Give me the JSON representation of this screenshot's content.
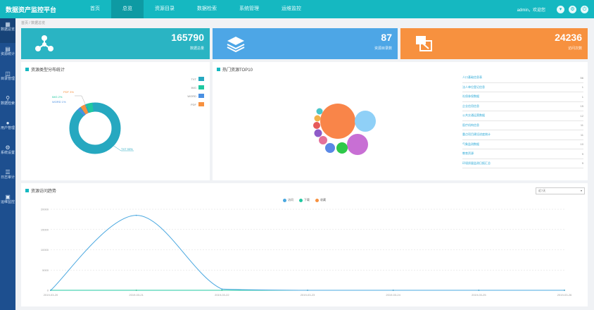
{
  "app": {
    "title": "数据资产监控平台"
  },
  "nav": [
    {
      "label": "首页",
      "active": false
    },
    {
      "label": "总览",
      "active": true
    },
    {
      "label": "资源目录",
      "active": false
    },
    {
      "label": "数据检索",
      "active": false
    },
    {
      "label": "系统管理",
      "active": false
    },
    {
      "label": "运维监控",
      "active": false
    }
  ],
  "user": {
    "name": "admin，欢迎您"
  },
  "sidebar": [
    {
      "label": "数据总览",
      "icon": "grid-icon"
    },
    {
      "label": "资源统计",
      "icon": "chart-icon"
    },
    {
      "label": "目录管理",
      "icon": "folder-icon"
    },
    {
      "label": "数据检索",
      "icon": "search-icon"
    },
    {
      "label": "用户管理",
      "icon": "user-icon"
    },
    {
      "label": "系统设置",
      "icon": "gear-icon"
    },
    {
      "label": "日志审计",
      "icon": "log-icon"
    },
    {
      "label": "运维监控",
      "icon": "monitor-icon"
    }
  ],
  "breadcrumb": "首页 / 数据总览",
  "stats": [
    {
      "value": "165790",
      "label": "数据总量",
      "icon": "share-icon",
      "color": "#2ab4c3"
    },
    {
      "value": "87",
      "label": "资源目录数",
      "icon": "layers-icon",
      "color": "#4da6e6"
    },
    {
      "value": "24236",
      "label": "访问次数",
      "icon": "share-screen-icon",
      "color": "#f7913f"
    }
  ],
  "donut_panel": {
    "title": "资源类型分布统计",
    "legend": [
      {
        "label": "TXT",
        "color": "#26a8c0"
      },
      {
        "label": "IMG",
        "color": "#1fc8a0"
      },
      {
        "label": "WORD",
        "color": "#4a90e2"
      },
      {
        "label": "PDF",
        "color": "#f7913f"
      }
    ],
    "big_label": "TXT 93%",
    "small_labels": [
      "IMG 2%",
      "WORD 1%",
      "PDF 3%"
    ]
  },
  "bubble_panel": {
    "title": "热门资源TOP10",
    "rows": [
      {
        "name": "人口基础信息表",
        "count": "56"
      },
      {
        "name": "法人单位登记信息",
        "count": "1"
      },
      {
        "name": "社保参保数据",
        "count": "1"
      },
      {
        "name": "企业信用信息",
        "count": "15"
      },
      {
        "name": "公共交通运营数据",
        "count": "12"
      },
      {
        "name": "医疗机构信息",
        "count": "11"
      },
      {
        "name": "重点项目建设进度统计",
        "count": "11"
      },
      {
        "name": "气象监测数据",
        "count": "10"
      },
      {
        "name": "教育资源",
        "count": "9"
      },
      {
        "name": "环境质量监测日报汇总",
        "count": "9"
      }
    ]
  },
  "trend_panel": {
    "title": "资源访问趋势",
    "select": "近7天",
    "legend": [
      {
        "label": "访问",
        "color": "#4aa8e0"
      },
      {
        "label": "下载",
        "color": "#1fc8a0"
      },
      {
        "label": "收藏",
        "color": "#f7913f"
      }
    ]
  },
  "chart_data": {
    "type": "line",
    "x": [
      "2019-03-20",
      "2019-03-21",
      "2019-03-22",
      "2019-03-23",
      "2019-03-24",
      "2019-03-25",
      "2019-03-26"
    ],
    "ylim": [
      0,
      20000
    ],
    "yticks": [
      "20000",
      "15000",
      "10000",
      "5000",
      "0"
    ],
    "series": [
      {
        "name": "访问",
        "color": "#4aa8e0",
        "values": [
          0,
          18500,
          300,
          0,
          0,
          0,
          0
        ]
      },
      {
        "name": "下载",
        "color": "#1fc8a0",
        "values": [
          0,
          0,
          0,
          0,
          0,
          0,
          0
        ]
      },
      {
        "name": "收藏",
        "color": "#f7913f",
        "values": [
          0,
          0,
          0,
          0,
          0,
          0,
          0
        ]
      }
    ]
  }
}
